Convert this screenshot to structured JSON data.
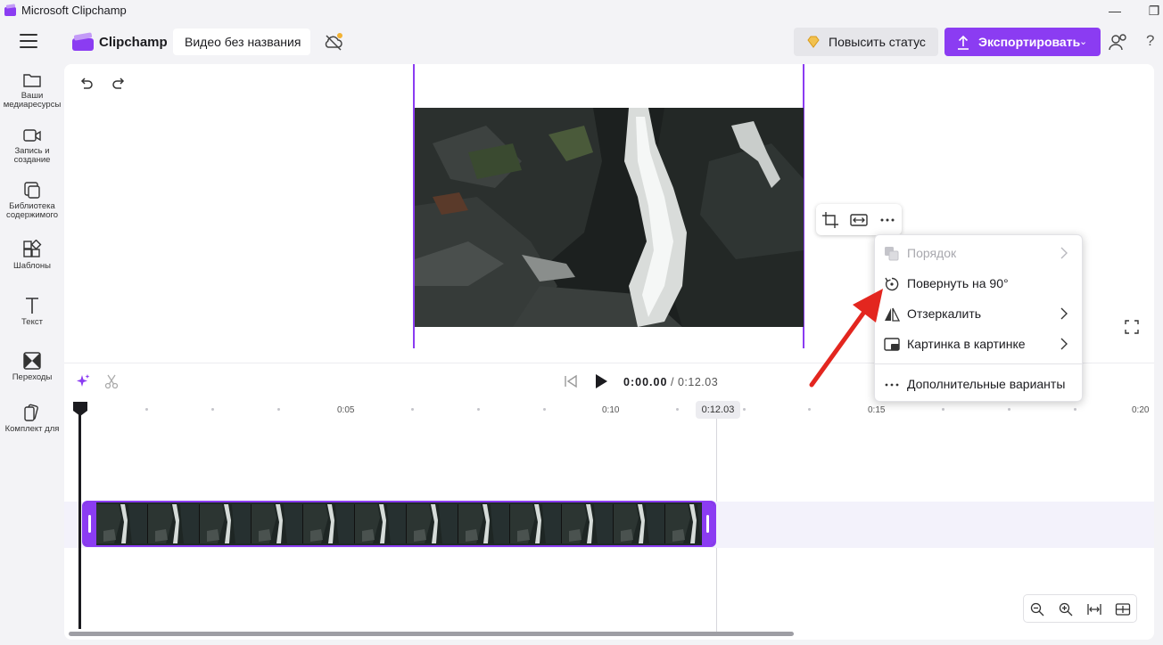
{
  "window": {
    "title": "Microsoft Clipchamp",
    "minimize": "—",
    "restore": "❐"
  },
  "header": {
    "brand": "Clipchamp",
    "project_title": "Видео без названия",
    "upgrade_label": "Повысить статус",
    "export_label": "Экспортировать",
    "export_chevron": "⌄",
    "help": "?"
  },
  "sidebar": {
    "items": [
      {
        "label": "Ваши медиаресурсы",
        "icon": "folder-icon"
      },
      {
        "label": "Запись и создание",
        "icon": "video-camera-icon"
      },
      {
        "label": "Библиотека содержимого",
        "icon": "library-icon"
      },
      {
        "label": "Шаблоны",
        "icon": "templates-icon"
      },
      {
        "label": "Текст",
        "icon": "text-icon"
      },
      {
        "label": "Переходы",
        "icon": "transitions-icon"
      },
      {
        "label": "Комплект для",
        "icon": "brand-kit-icon"
      }
    ]
  },
  "context_menu": {
    "items": [
      {
        "label": "Порядок",
        "icon": "layers-icon",
        "disabled": true,
        "submenu": true
      },
      {
        "label": "Повернуть на 90°",
        "icon": "rotate-icon",
        "disabled": false,
        "submenu": false
      },
      {
        "label": "Отзеркалить",
        "icon": "flip-icon",
        "disabled": false,
        "submenu": true
      },
      {
        "label": "Картинка в картинке",
        "icon": "picture-in-picture-icon",
        "disabled": false,
        "submenu": true
      },
      {
        "label": "Дополнительные варианты",
        "icon": "more-icon",
        "disabled": false,
        "submenu": false
      }
    ]
  },
  "timeline": {
    "current_time": "0:00.00",
    "total_time": "/ 0:12.03",
    "end_marker": "0:12.03",
    "ruler_labels": [
      "0:05",
      "0:10",
      "0:15",
      "0:20"
    ]
  },
  "colors": {
    "accent": "#8b3cf2",
    "annotation_arrow": "#e3261f"
  }
}
